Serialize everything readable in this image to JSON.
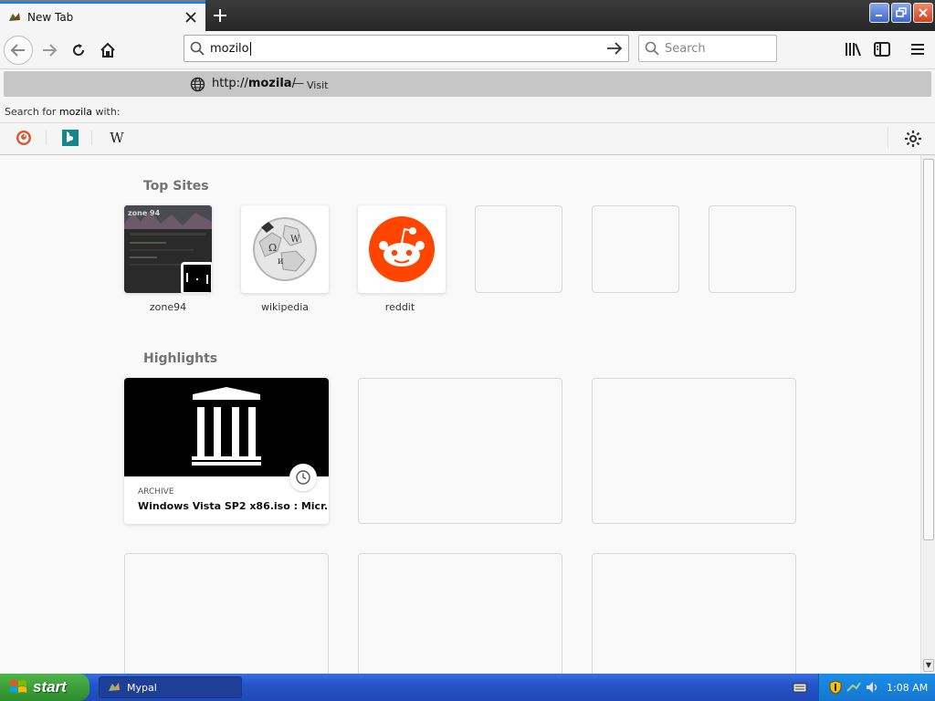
{
  "tab": {
    "title": "New Tab"
  },
  "navbar": {
    "url_value": "mozilo",
    "search_placeholder": "Search"
  },
  "popup": {
    "suggestion_prefix": "http://",
    "suggestion_bold": "mozila",
    "suggestion_suffix": "/",
    "suggestion_dash": "—",
    "visit_label": "Visit",
    "search_for_prefix": "Search for ",
    "search_for_term": "mozila",
    "search_for_suffix": " with:",
    "engines": [
      "duckduckgo-icon",
      "bing-icon",
      "wikipedia-icon"
    ],
    "wikipedia_glyph": "W"
  },
  "content": {
    "top_sites_title": "Top Sites",
    "top_sites": [
      {
        "label": "zone94",
        "icon": "zone94-thumbnail"
      },
      {
        "label": "wikipedia",
        "icon": "wikipedia-globe-icon"
      },
      {
        "label": "reddit",
        "icon": "reddit-icon"
      }
    ],
    "highlights_title": "Highlights",
    "highlights": [
      {
        "source": "ARCHIVE",
        "title": "Windows Vista SP2 x86.iso : Micr..."
      }
    ],
    "zone94_banner": "zone 94"
  },
  "taskbar": {
    "start_label": "start",
    "task_label": "Mypal",
    "clock": "1:08 AM"
  },
  "colors": {
    "accent": "#0a84ff",
    "reddit": "#ff4500",
    "taskbar": "#2454c9",
    "start": "#3a9f37"
  }
}
